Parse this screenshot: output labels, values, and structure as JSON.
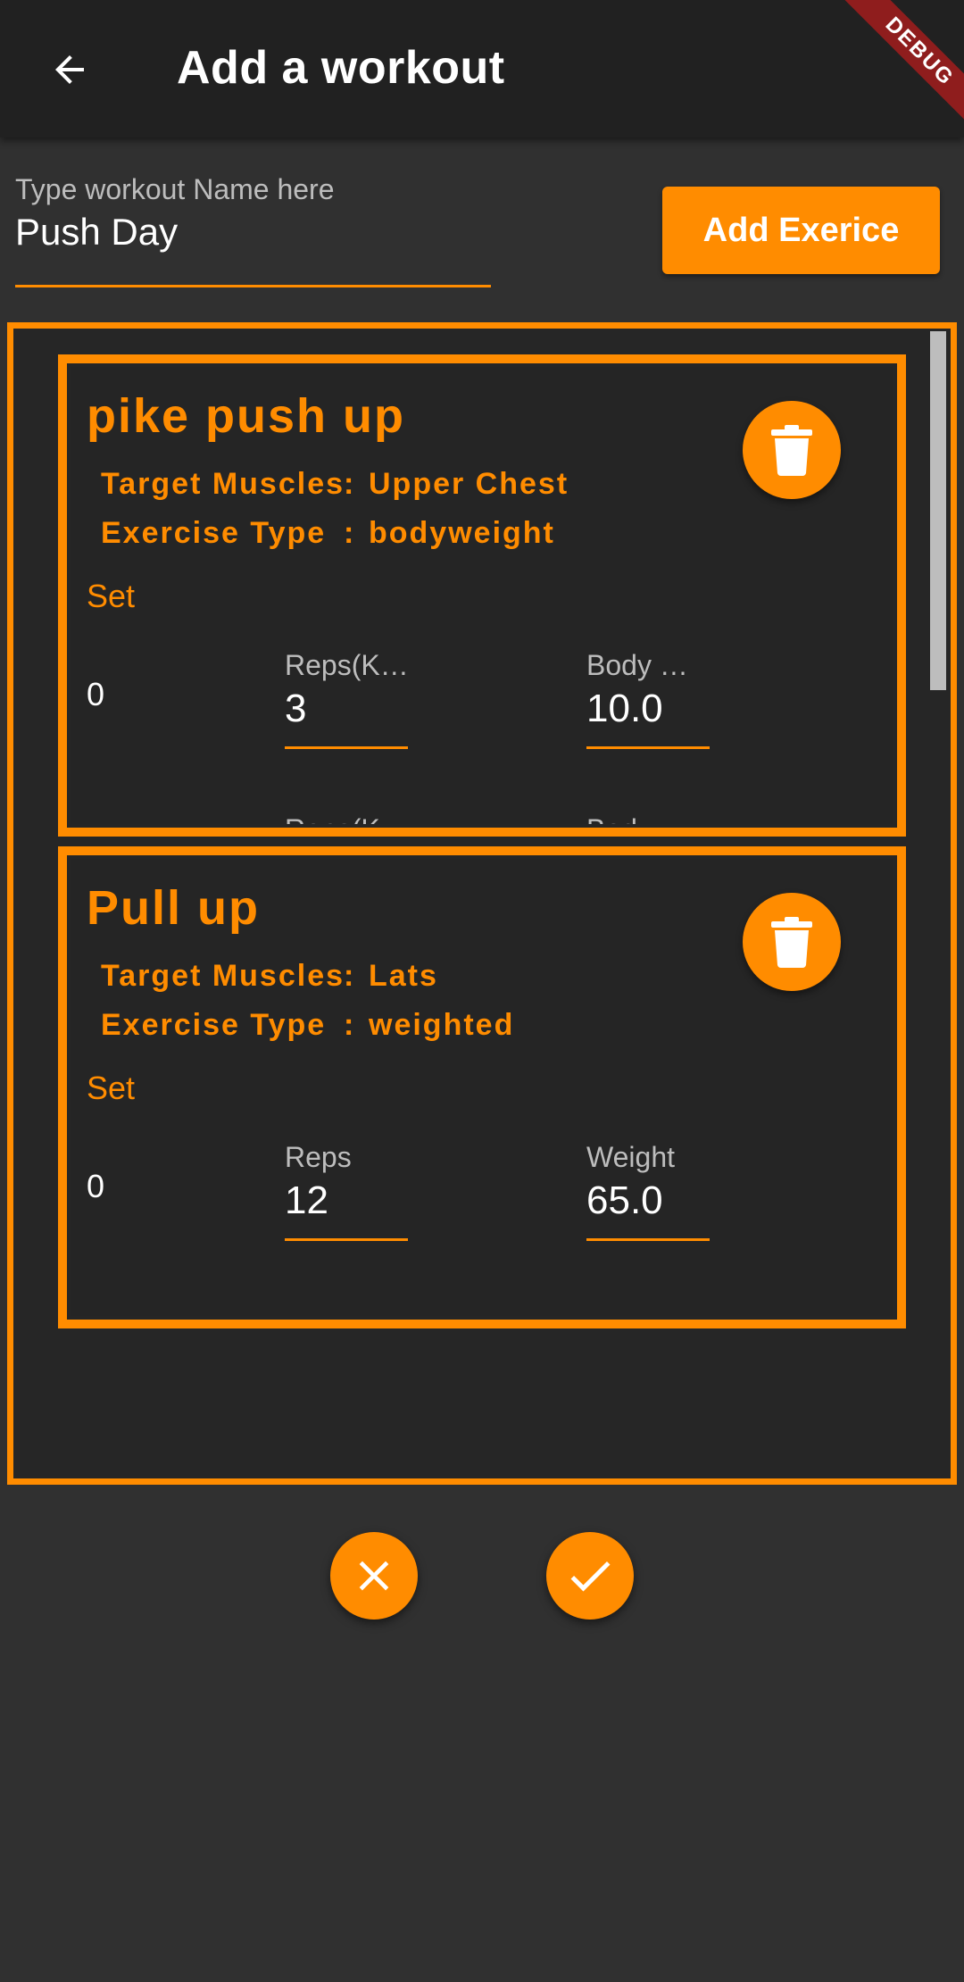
{
  "appbar": {
    "title": "Add a workout",
    "back_icon": "arrow-back-icon"
  },
  "debug_banner": "DEBUG",
  "workout_name": {
    "label": "Type workout Name here",
    "value": "Push Day"
  },
  "add_exercise_button": "Add Exerice",
  "exercises": [
    {
      "title": "pike push up",
      "target_label": "Target Muscles",
      "target_value": "Upper Chest",
      "type_label": "Exercise Type",
      "type_value": "bodyweight",
      "set_label": "Set",
      "sets": [
        {
          "index": "0",
          "field1_label": "Reps(K…",
          "field1_value": "3",
          "field2_label": "Body …",
          "field2_value": "10.0"
        },
        {
          "index": "",
          "field1_label": "Reps(K…",
          "field1_value": "",
          "field2_label": "Body …",
          "field2_value": ""
        }
      ]
    },
    {
      "title": "Pull up",
      "target_label": "Target Muscles",
      "target_value": "Lats",
      "type_label": "Exercise Type",
      "type_value": "weighted",
      "set_label": "Set",
      "sets": [
        {
          "index": "0",
          "field1_label": "Reps",
          "field1_value": "12",
          "field2_label": "Weight",
          "field2_value": "65.0"
        }
      ]
    }
  ],
  "colors": {
    "accent": "#ff8c00",
    "background": "#303030",
    "appbar": "#212121",
    "card": "#252525"
  }
}
